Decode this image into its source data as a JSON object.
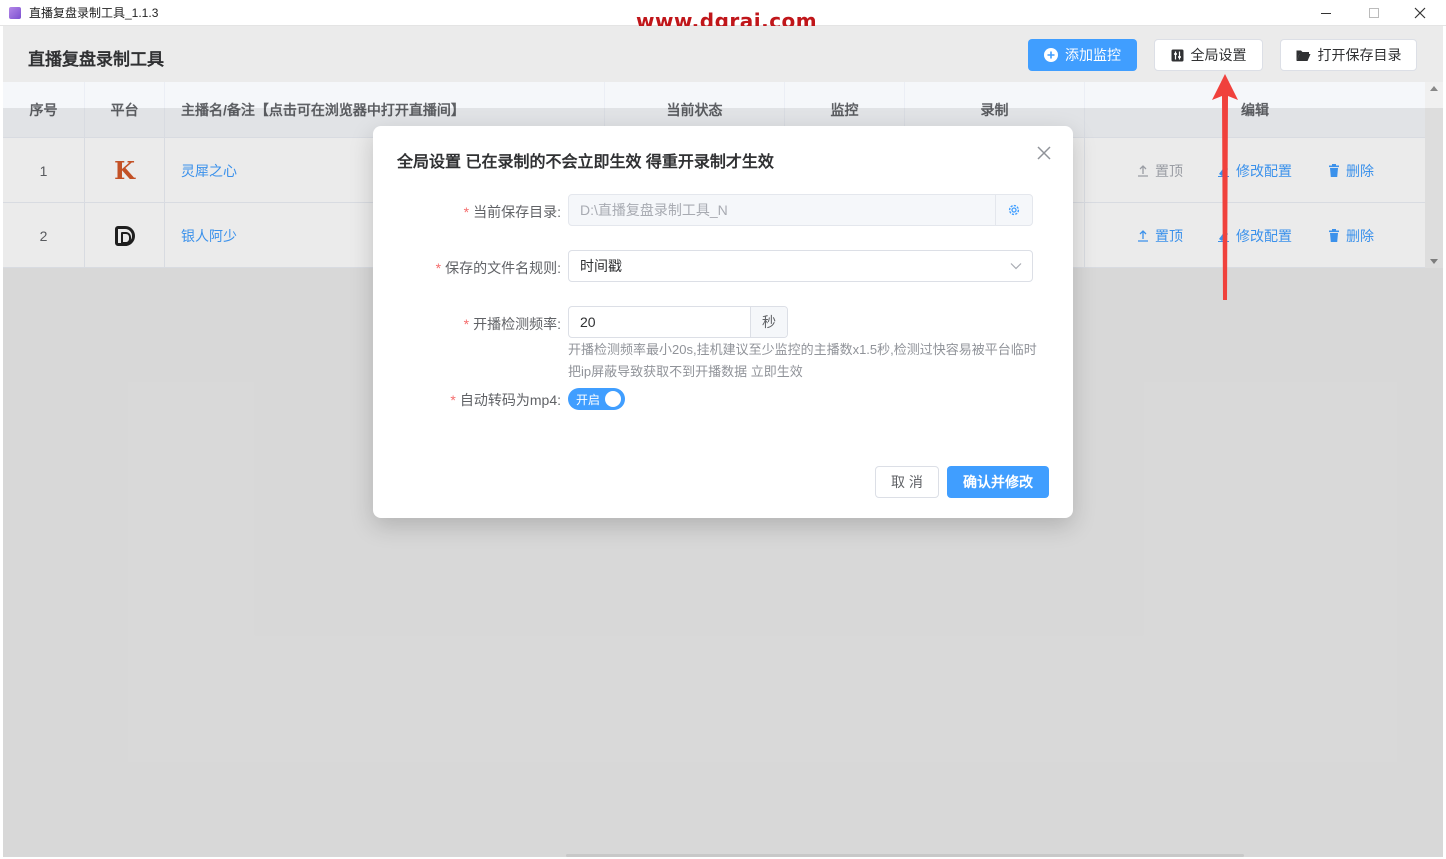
{
  "window": {
    "title": "直播复盘录制工具_1.1.3",
    "watermark": "www.dgrai.com",
    "controls": [
      "minimize",
      "maximize",
      "close"
    ]
  },
  "header": {
    "title": "直播复盘录制工具",
    "add_label": "添加监控",
    "global_label": "全局设置",
    "open_label": "打开保存目录"
  },
  "table": {
    "columns": [
      "序号",
      "平台",
      "主播名/备注【点击可在浏览器中打开直播间】",
      "当前状态",
      "监控",
      "录制",
      "编辑"
    ],
    "rows": [
      {
        "num": "1",
        "platform_icon": "kuaishou-icon",
        "name": "灵犀之心",
        "top": "置顶",
        "modify": "修改配置",
        "delete": "删除"
      },
      {
        "num": "2",
        "platform_icon": "douyin-icon",
        "name": "银人阿少",
        "top": "置顶",
        "modify": "修改配置",
        "delete": "删除"
      }
    ]
  },
  "dialog": {
    "title": "全局设置 已在录制的不会立即生效 得重开录制才生效",
    "fields": {
      "dir_label": "当前保存目录:",
      "dir_value": "D:\\直播复盘录制工具_N",
      "rule_label": "保存的文件名规则:",
      "rule_value": "时间戳",
      "freq_label": "开播检测频率:",
      "freq_value": "20",
      "freq_unit": "秒",
      "freq_hint": "开播检测频率最小20s,挂机建议至少监控的主播数x1.5秒,检测过快容易被平台临时把ip屏蔽导致获取不到开播数据 立即生效",
      "mp4_label": "自动转码为mp4:",
      "mp4_switch": "开启"
    },
    "cancel_label": "取 消",
    "confirm_label": "确认并修改"
  },
  "colors": {
    "primary": "#409eff",
    "required": "#f56c6c",
    "arrow": "#f0413c",
    "watermark": "#c0161a"
  }
}
